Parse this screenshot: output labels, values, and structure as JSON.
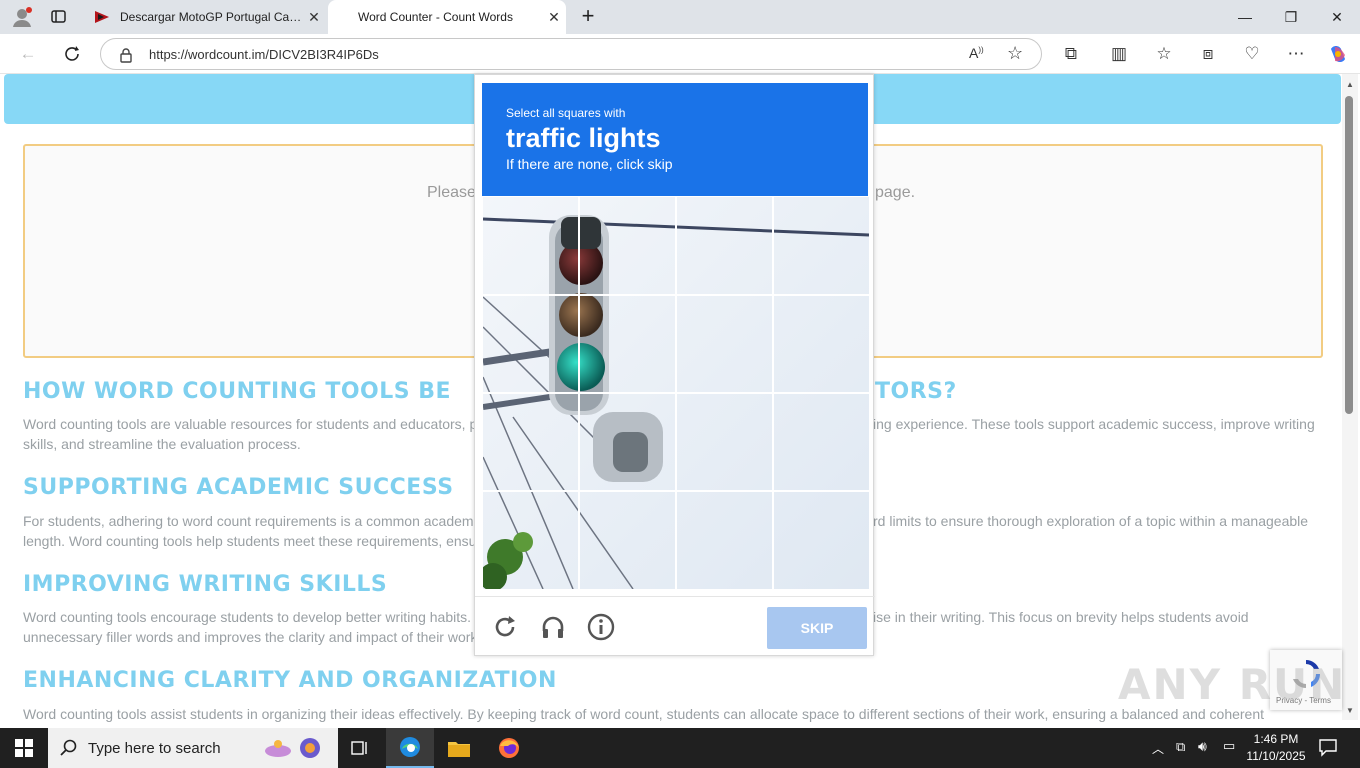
{
  "browser": {
    "tabs": [
      {
        "title": "Descargar MotoGP Portugal Carre",
        "active": false
      },
      {
        "title": "Word Counter - Count Words",
        "active": true
      }
    ],
    "url": "https://wordcount.im/DICV2BI3R4IP6Ds"
  },
  "page": {
    "placeholder_left": "Please",
    "placeholder_right": "page.",
    "sections": [
      {
        "heading_left": "HOW WORD COUNTING TOOLS BE",
        "heading_right": "TORS?",
        "body_left": "Word counting tools are valuable resources for students and educators, p",
        "body_right": "ing experience. These tools support academic success, improve writing",
        "body_line2": "skills, and streamline the evaluation process."
      },
      {
        "heading_left": "SUPPORTING ACADEMIC SUCCESS",
        "body_left": "For students, adhering to word count requirements is a common academ",
        "body_right": "rd limits to ensure thorough exploration of a topic within a manageable",
        "body_line2": "length. Word counting tools help students meet these requirements, ensu"
      },
      {
        "heading_left": "IMPROVING WRITING SKILLS",
        "body_left": "Word counting tools encourage students to develop better writing habits.",
        "body_right": "ise in their writing. This focus on brevity helps students avoid",
        "body_line2": "unnecessary filler words and improves the clarity and impact of their work"
      },
      {
        "heading_left": "ENHANCING CLARITY AND ORGANIZATION",
        "body_left": "Word counting tools assist students in organizing their ideas effectively. By keeping track of word count, students can allocate space to different sections of their work, ensuring a balanced and coherent"
      }
    ]
  },
  "captcha": {
    "line1": "Select all squares with",
    "line2": "traffic lights",
    "line3": "If there are none, click skip",
    "skip_label": "SKIP",
    "icons": [
      "reload-icon",
      "audio-icon",
      "info-icon"
    ]
  },
  "badge": {
    "text": "Privacy - Terms"
  },
  "watermark": "ANY RUN",
  "taskbar": {
    "search_placeholder": "Type here to search",
    "time": "1:46 PM",
    "date": "11/10/2025"
  },
  "colors": {
    "captcha_blue": "#1a73e8",
    "heading_blue": "#7fd0ef",
    "top_strip": "#87d8f6",
    "textbox_border": "#f2cc82"
  }
}
